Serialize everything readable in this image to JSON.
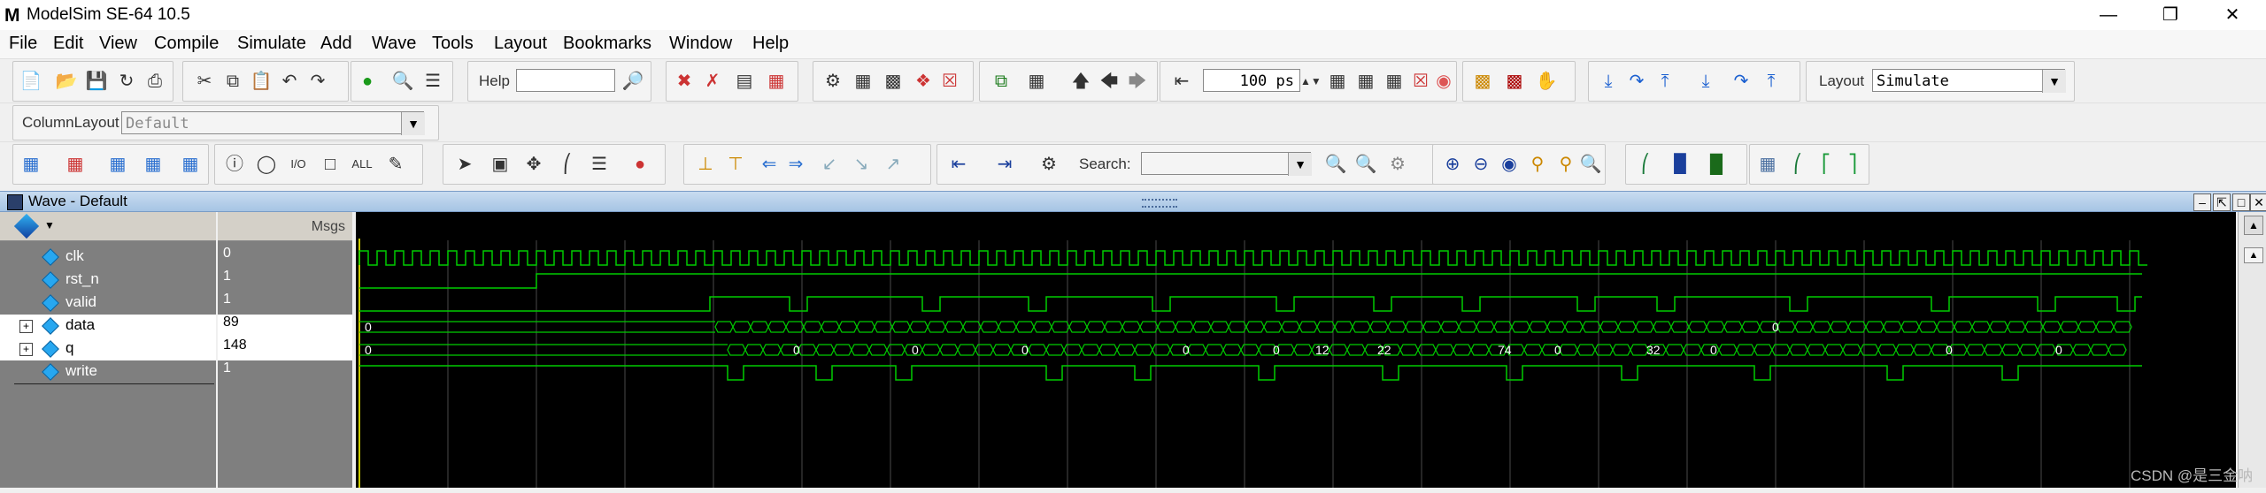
{
  "window": {
    "title": "ModelSim SE-64 10.5",
    "logo": "M"
  },
  "menu": [
    "File",
    "Edit",
    "View",
    "Compile",
    "Simulate",
    "Add",
    "Wave",
    "Tools",
    "Layout",
    "Bookmarks",
    "Window",
    "Help"
  ],
  "toolbar": {
    "help_label": "Help",
    "help_value": "",
    "run_length": "100 ps",
    "layout_label": "Layout",
    "layout_value": "Simulate",
    "column_layout_label": "ColumnLayout",
    "column_layout_value": "Default",
    "search_label": "Search:",
    "search_value": ""
  },
  "wave_window": {
    "title": "Wave - Default",
    "msgs_header": "Msgs"
  },
  "signals": [
    {
      "name": "clk",
      "value": "0",
      "bus": false
    },
    {
      "name": "rst_n",
      "value": "1",
      "bus": false
    },
    {
      "name": "valid",
      "value": "1",
      "bus": false
    },
    {
      "name": "data",
      "value": "89",
      "bus": true
    },
    {
      "name": "q",
      "value": "148",
      "bus": true
    },
    {
      "name": "write",
      "value": "1",
      "bus": false
    }
  ],
  "wave_labels": {
    "data": [
      "0",
      "0"
    ],
    "q": [
      "0",
      "0",
      "0",
      "0",
      "0",
      "0",
      "12",
      "22",
      "74",
      "0",
      "32",
      "0",
      "0",
      "0"
    ]
  },
  "colors": {
    "wave": "#00cc00",
    "cursor": "#c8c800",
    "grid": "#4a4a4a",
    "wave_bg": "#000000"
  },
  "watermark": "CSDN @是三金呐"
}
